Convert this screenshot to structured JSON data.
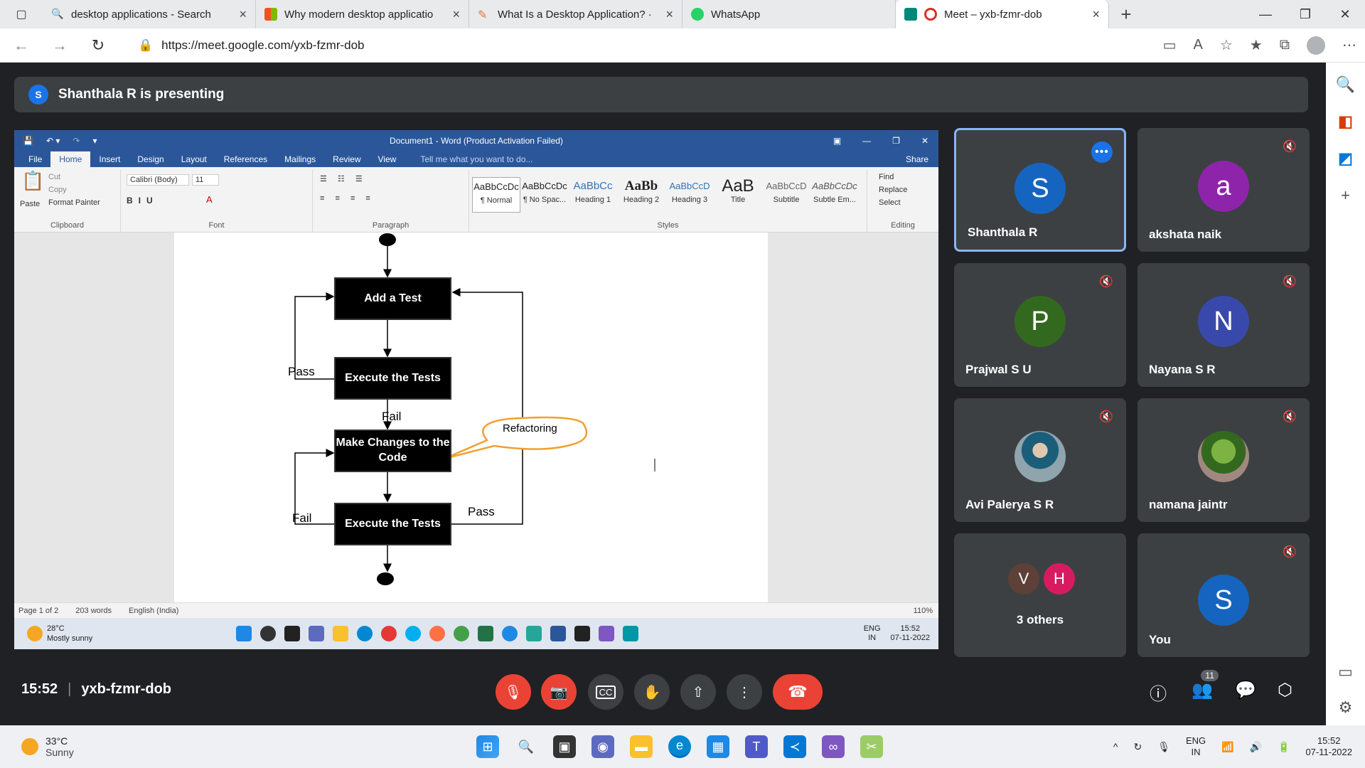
{
  "browser": {
    "tabs": [
      {
        "title": "desktop applications - Search",
        "icon": "search-icon",
        "color": "#666666"
      },
      {
        "title": "Why modern desktop applicatio",
        "icon": "windows-logo-icon",
        "color": "#f25022"
      },
      {
        "title": "What Is a Desktop Application? ·",
        "icon": "feather-icon",
        "color": "#e8713c"
      },
      {
        "title": "WhatsApp",
        "icon": "whatsapp-icon",
        "color": "#25d366"
      },
      {
        "title": "Meet – yxb-fzmr-dob",
        "icon": "meet-icon",
        "color": "#00897b"
      }
    ],
    "url": "https://meet.google.com/yxb-fzmr-dob"
  },
  "meet": {
    "presenting_initial": "S",
    "presenting_text": "Shanthala R is presenting",
    "time": "15:52",
    "meeting_code": "yxb-fzmr-dob",
    "participant_count": "11",
    "participants": [
      {
        "name": "Shanthala R",
        "initial": "S",
        "color": "#1565c0",
        "active": true
      },
      {
        "name": "akshata naik",
        "initial": "a",
        "color": "#8e24aa",
        "active": false
      },
      {
        "name": "Prajwal S U",
        "initial": "P",
        "color": "#33691e",
        "active": false
      },
      {
        "name": "Nayana S R",
        "initial": "N",
        "color": "#3949ab",
        "active": false
      },
      {
        "name": "Avi Palerya S R",
        "initial": "",
        "color": "#90a4ae",
        "active": false
      },
      {
        "name": "namana jaintr",
        "initial": "",
        "color": "#558b2f",
        "active": false
      },
      {
        "name": "3 others",
        "initial": "",
        "color": "#3c4043",
        "active": false
      },
      {
        "name": "You",
        "initial": "S",
        "color": "#1565c0",
        "active": false
      }
    ],
    "others_initials": [
      "V",
      "H"
    ]
  },
  "word": {
    "doc_title": "Document1 - Word (Product Activation Failed)",
    "tabs": [
      "File",
      "Home",
      "Insert",
      "Design",
      "Layout",
      "References",
      "Mailings",
      "Review",
      "View"
    ],
    "tell_me": "Tell me what you want to do...",
    "share": "Share",
    "clipboard": {
      "paste": "Paste",
      "cut": "Cut",
      "copy": "Copy",
      "format_painter": "Format Painter",
      "label": "Clipboard"
    },
    "font": {
      "name": "Calibri (Body)",
      "size": "11",
      "label": "Font"
    },
    "paragraph_label": "Paragraph",
    "styles_label": "Styles",
    "styles": [
      {
        "preview": "AaBbCcDc",
        "name": "¶ Normal"
      },
      {
        "preview": "AaBbCcDc",
        "name": "¶ No Spac..."
      },
      {
        "preview": "AaBbCc",
        "name": "Heading 1"
      },
      {
        "preview": "AaBb",
        "name": "Heading 2"
      },
      {
        "preview": "AaBbCcD",
        "name": "Heading 3"
      },
      {
        "preview": "AaB",
        "name": "Title"
      },
      {
        "preview": "AaBbCcD",
        "name": "Subtitle"
      },
      {
        "preview": "AaBbCcDc",
        "name": "Subtle Em..."
      }
    ],
    "editing": {
      "find": "Find",
      "replace": "Replace",
      "select": "Select",
      "label": "Editing"
    },
    "flow": {
      "box1": "Add a Test",
      "box2": "Execute the Tests",
      "box3": "Make Changes to the Code",
      "box4": "Execute the Tests",
      "pass1": "Pass",
      "fail1": "Fail",
      "fail2": "Fail",
      "pass2": "Pass",
      "callout": "Refactoring"
    },
    "status": {
      "page": "Page 1 of 2",
      "words": "203 words",
      "lang": "English (India)",
      "zoom": "110%"
    },
    "inner_taskbar": {
      "temp": "28°C",
      "weather": "Mostly sunny",
      "lang1": "ENG",
      "lang2": "IN",
      "time": "15:52",
      "date": "07-11-2022"
    }
  },
  "taskbar": {
    "temp": "33°C",
    "weather": "Sunny",
    "lang1": "ENG",
    "lang2": "IN",
    "time": "15:52",
    "date": "07-11-2022"
  }
}
